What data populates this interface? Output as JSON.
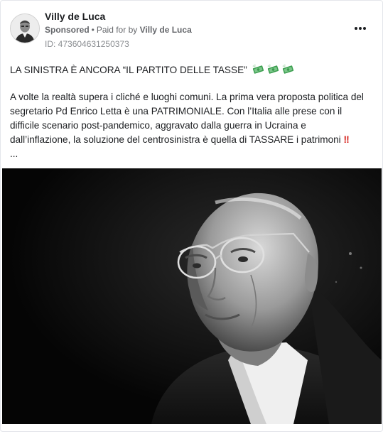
{
  "post": {
    "author_name": "Villy de Luca",
    "sponsored_label": "Sponsored",
    "separator": "•",
    "paid_for_prefix": "Paid for by",
    "payer_name": "Villy de Luca",
    "ad_id": "ID: 473604631250373",
    "more_options_icon": "more-horizontal-icon"
  },
  "content": {
    "headline": "LA SINISTRA È ANCORA “IL PARTITO DELLE TASSE”",
    "headline_icon": "money-with-wings-icon",
    "headline_icon_count": 3,
    "paragraph_lines": [
      "A volte la realtà supera i cliché e luoghi comuni. La prima vera proposta politica del",
      "segretario Pd Enrico Letta è una PATRIMONIALE. Con l’Italia alle prese con il",
      "difficile scenario post-pandemico, aggravato dalla guerra in Ucraina e",
      "dall’inflazione, la soluzione del centrosinistra è quella di TASSARE i patrimoni"
    ],
    "last_line_emoji": "‼",
    "truncation": "..."
  },
  "colors": {
    "text_primary": "#1c1e21",
    "text_secondary": "#65676b",
    "emoji_red": "#d6211b",
    "money_green": "#3a9e4e"
  }
}
